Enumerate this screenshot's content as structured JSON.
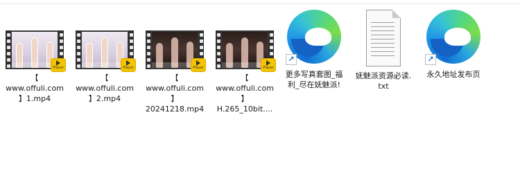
{
  "files": [
    {
      "type": "video",
      "name": "【\nwww.offuli.com\n】1.mp4",
      "badge": "Player"
    },
    {
      "type": "video",
      "name": "【\nwww.offuli.com\n】2.mp4",
      "badge": "Player"
    },
    {
      "type": "video",
      "name": "【\nwww.offuli.com\n】\n20241218.mp4",
      "badge": "Player"
    },
    {
      "type": "video",
      "name": "【\nwww.offuli.com\n】\nH.265_10bit....",
      "badge": "Player"
    },
    {
      "type": "shortcut",
      "name": "更多写真套图_福\n利_尽在妩魅派!",
      "icon": "edge-browser-icon"
    },
    {
      "type": "text",
      "name": "妩魅派资源必读.\ntxt",
      "icon": "text-file-icon"
    },
    {
      "type": "shortcut",
      "name": "永久地址发布页",
      "icon": "edge-browser-icon"
    }
  ],
  "colors": {
    "badge": "#f5c400",
    "edge_blue": "#0f6fd1",
    "edge_green": "#4fd58b"
  }
}
